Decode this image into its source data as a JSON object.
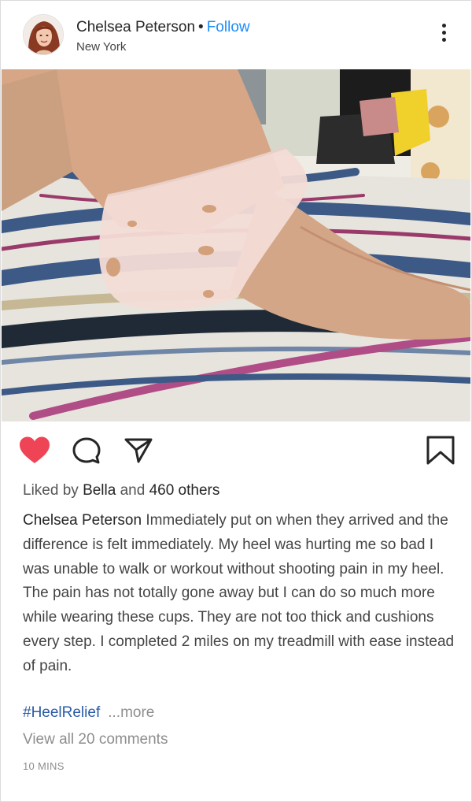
{
  "post": {
    "user": {
      "name": "Chelsea Peterson",
      "separator": "•",
      "follow_label": "Follow",
      "location": "New York"
    },
    "image_alt": "Foot wearing a silicone heel cup on a striped bed sheet",
    "likes": {
      "prefix": "Liked by",
      "liker": "Bella",
      "conjunction": "and",
      "others": "460 others"
    },
    "caption": {
      "username": "Chelsea Peterson",
      "text": "Immediately put on when they arrived and the difference is felt immediately. My heel was hurting me so bad I was unable to walk or workout without shooting pain in my heel. The pain has not totally gone away but I can do so much more while wearing these cups. They are not too thick and cushions every step. I completed 2 miles on my treadmill with ease instead of pain."
    },
    "hashtag": "#HeelRelief",
    "more_label": "...more",
    "view_comments": "View all 20 comments",
    "timestamp": "10 MINS"
  },
  "icons": {
    "like": "heart-icon",
    "comment": "comment-icon",
    "share": "paper-plane-icon",
    "save": "bookmark-icon",
    "options": "more-vertical-icon"
  },
  "colors": {
    "like_active": "#ef4455",
    "follow": "#1d8cf8",
    "hashtag": "#2a5ba8",
    "muted": "#8e8e8e"
  }
}
